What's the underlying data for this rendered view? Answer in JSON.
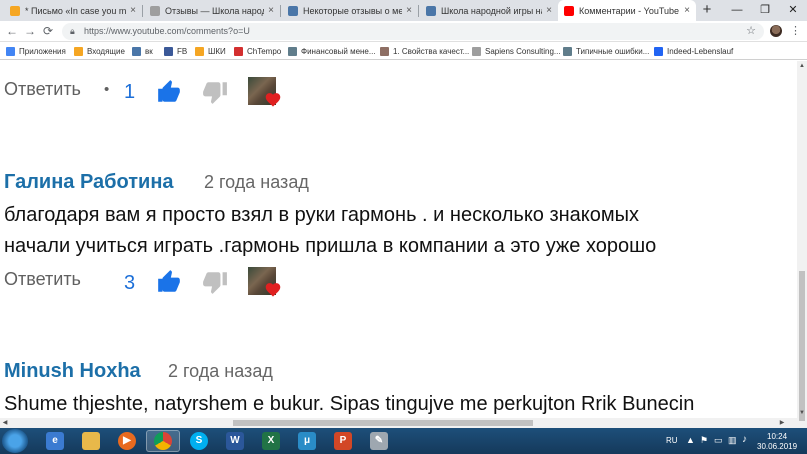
{
  "browser": {
    "tabs": [
      {
        "title": "* Письмо «In case you missed it",
        "favicon_color": "#f5a623",
        "active": false
      },
      {
        "title": "Отзывы — Школа народной иг",
        "favicon_color": "#9e9e9e",
        "active": false
      },
      {
        "title": "Некоторые отзывы о методик",
        "favicon_color": "#4a76a8",
        "active": false
      },
      {
        "title": "Школа народной игры на гарм",
        "favicon_color": "#4a76a8",
        "active": false
      },
      {
        "title": "Комментарии - YouTube",
        "favicon_color": "#ff0000",
        "active": true
      }
    ],
    "tab_close_glyph": "×",
    "new_tab_glyph": "+",
    "window_controls": {
      "minimize": "—",
      "maximize": "❐",
      "close": "✕"
    },
    "url": "https://www.youtube.com/comments?o=U",
    "bookmarks": [
      {
        "label": "Приложения",
        "icon": "apps-grid-icon",
        "color": "#4285f4"
      },
      {
        "label": "Входящие",
        "icon": "mail-icon",
        "color": "#f5a623"
      },
      {
        "label": "вк",
        "icon": "vk-icon",
        "color": "#4a76a8"
      },
      {
        "label": "FB",
        "icon": "facebook-icon",
        "color": "#3b5998"
      },
      {
        "label": "ШКИ",
        "icon": "school-icon",
        "color": "#f5a623"
      },
      {
        "label": "ChTempo",
        "icon": "chtempo-icon",
        "color": "#d32f2f"
      },
      {
        "label": "Финансовый мене...",
        "icon": "finance-icon",
        "color": "#607d8b"
      },
      {
        "label": "1. Свойства качест...",
        "icon": "doc-icon",
        "color": "#8d6e63"
      },
      {
        "label": "Sapiens Consulting...",
        "icon": "page-icon",
        "color": "#9e9e9e"
      },
      {
        "label": "Типичные ошибки...",
        "icon": "ladder-icon",
        "color": "#607d8b"
      },
      {
        "label": "Indeed-Lebenslauf",
        "icon": "indeed-icon",
        "color": "#2164f3"
      }
    ]
  },
  "comments": [
    {
      "reply_label": "Ответить",
      "likes": "1"
    },
    {
      "author": "Галина Работина",
      "time_ago": "2 года назад",
      "text_lines": [
        "благодаря вам я просто взял в руки гармонь . и несколько знакомых",
        "начали учиться играть .гармонь пришла в компании а это уже хорошо"
      ],
      "reply_label": "Ответить",
      "likes": "3"
    },
    {
      "author": "Minush Hoxha",
      "time_ago": "2 года назад",
      "text_lines": [
        "Shume thjeshte, natyrshem e bukur. Sipas tingujve me perkujton Rrik Bunecin"
      ]
    }
  ],
  "separator_dot": "•",
  "colors": {
    "author": "#1c6fa8",
    "like_count": "#1c6fd8",
    "thumb_up": "#1a73e8",
    "thumb_down": "#c0c0c0",
    "heart": "#e02020",
    "taskbar": "#1d4f7a"
  },
  "taskbar": {
    "apps": [
      "explorer-icon",
      "media-player-icon",
      "chrome-icon",
      "skype-icon",
      "word-icon",
      "excel-icon",
      "mu-icon",
      "presentation-icon",
      "paint-icon"
    ],
    "language": "RU",
    "time": "10:24",
    "date": "30.06.2019"
  }
}
